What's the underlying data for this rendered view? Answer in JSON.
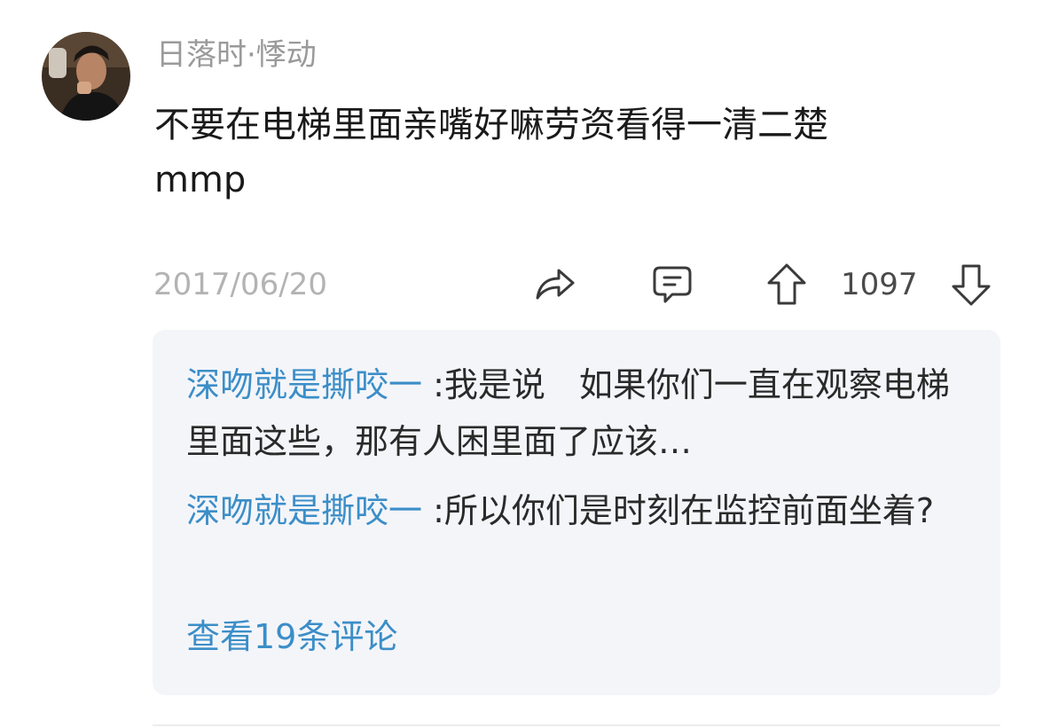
{
  "comment": {
    "username": "日落时·悸动",
    "text": "不要在电梯里面亲嘴好嘛劳资看得一清二楚\nmmp",
    "date": "2017/06/20",
    "vote_count": "1097",
    "icons": {
      "share": "share-icon",
      "reply": "comment-icon",
      "upvote": "arrow-up-icon",
      "downvote": "arrow-down-icon"
    }
  },
  "replies": [
    {
      "author": "深吻就是撕咬一",
      "separator": ":",
      "text": "我是说　如果你们一直在观察电梯里面这些，那有人困里面了应该…"
    },
    {
      "author": "深吻就是撕咬一",
      "separator": ":",
      "text": "所以你们是时刻在监控前面坐着?"
    }
  ],
  "view_more_label": "查看19条评论",
  "colors": {
    "link_blue": "#3b8ec8",
    "meta_gray": "#9a9a9a",
    "reply_bg": "#f4f5f9"
  }
}
